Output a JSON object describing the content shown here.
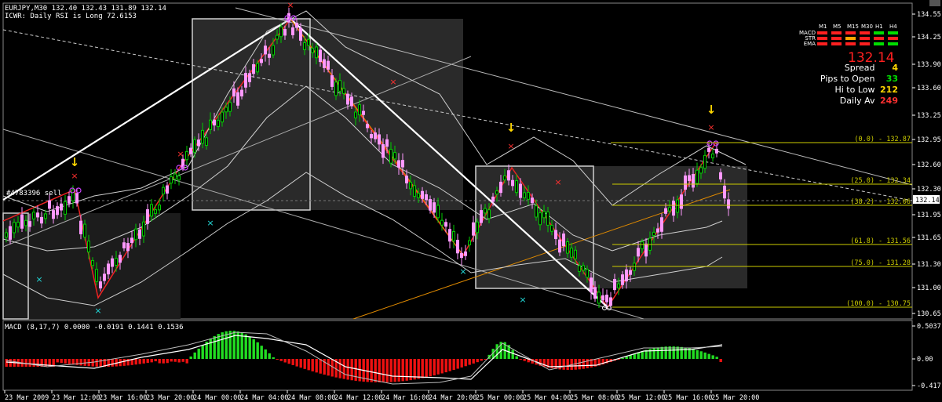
{
  "window": {
    "symbol_line": "EURJPY,M30  132.40 132.43 131.89 132.14",
    "indicator_line": "ICWR: Daily RSI is Long 72.6153",
    "order_label": "#4783396 sell"
  },
  "price_axis": {
    "labels": [
      "134.55",
      "134.25",
      "133.90",
      "133.60",
      "133.25",
      "132.95",
      "132.60",
      "132.30",
      "131.95",
      "131.65",
      "131.30",
      "131.00",
      "130.65"
    ],
    "current": "132.14"
  },
  "macd_axis": {
    "labels": [
      "0.5037",
      "0.00",
      "-0.417"
    ]
  },
  "macd": {
    "title": "MACD  (8,17,7) 0.0000 -0.0191 0.1441 0.1536"
  },
  "time_axis": {
    "labels": [
      "23 Mar 2009",
      "23 Mar 12:00",
      "23 Mar 16:00",
      "23 Mar 20:00",
      "24 Mar 00:00",
      "24 Mar 04:00",
      "24 Mar 08:00",
      "24 Mar 12:00",
      "24 Mar 16:00",
      "24 Mar 20:00",
      "25 Mar 00:00",
      "25 Mar 04:00",
      "25 Mar 08:00",
      "25 Mar 12:00",
      "25 Mar 16:00",
      "25 Mar 20:00"
    ]
  },
  "fib_labels": [
    "(0.0) - 132.87",
    "(25.0) - 132.34",
    "(38.2) - 132.06",
    "(61.8) - 131.56",
    "(75.0) - 131.28",
    "(100.0) - 130.75"
  ],
  "mtf_panel": {
    "timeframes": [
      "M1",
      "M5",
      "M15",
      "M30",
      "H1",
      "H4"
    ],
    "rows": [
      "MACD",
      "STR",
      "EMA"
    ],
    "price": "132.14",
    "stats": [
      {
        "label": "Spread",
        "value": "4",
        "color": "#ffd700"
      },
      {
        "label": "Pips to Open",
        "value": "33",
        "color": "#00e000"
      },
      {
        "label": "Hi to Low",
        "value": "212",
        "color": "#ffd700"
      },
      {
        "label": "Daily Av",
        "value": "249",
        "color": "#ff3030"
      }
    ]
  },
  "colors": {
    "bull": "#ff99ff",
    "bear": "#00cc00",
    "axis": "#ffffff",
    "macd_pos": "#22dd22",
    "macd_neg": "#ee1111",
    "price_big": "#ff2020"
  }
}
